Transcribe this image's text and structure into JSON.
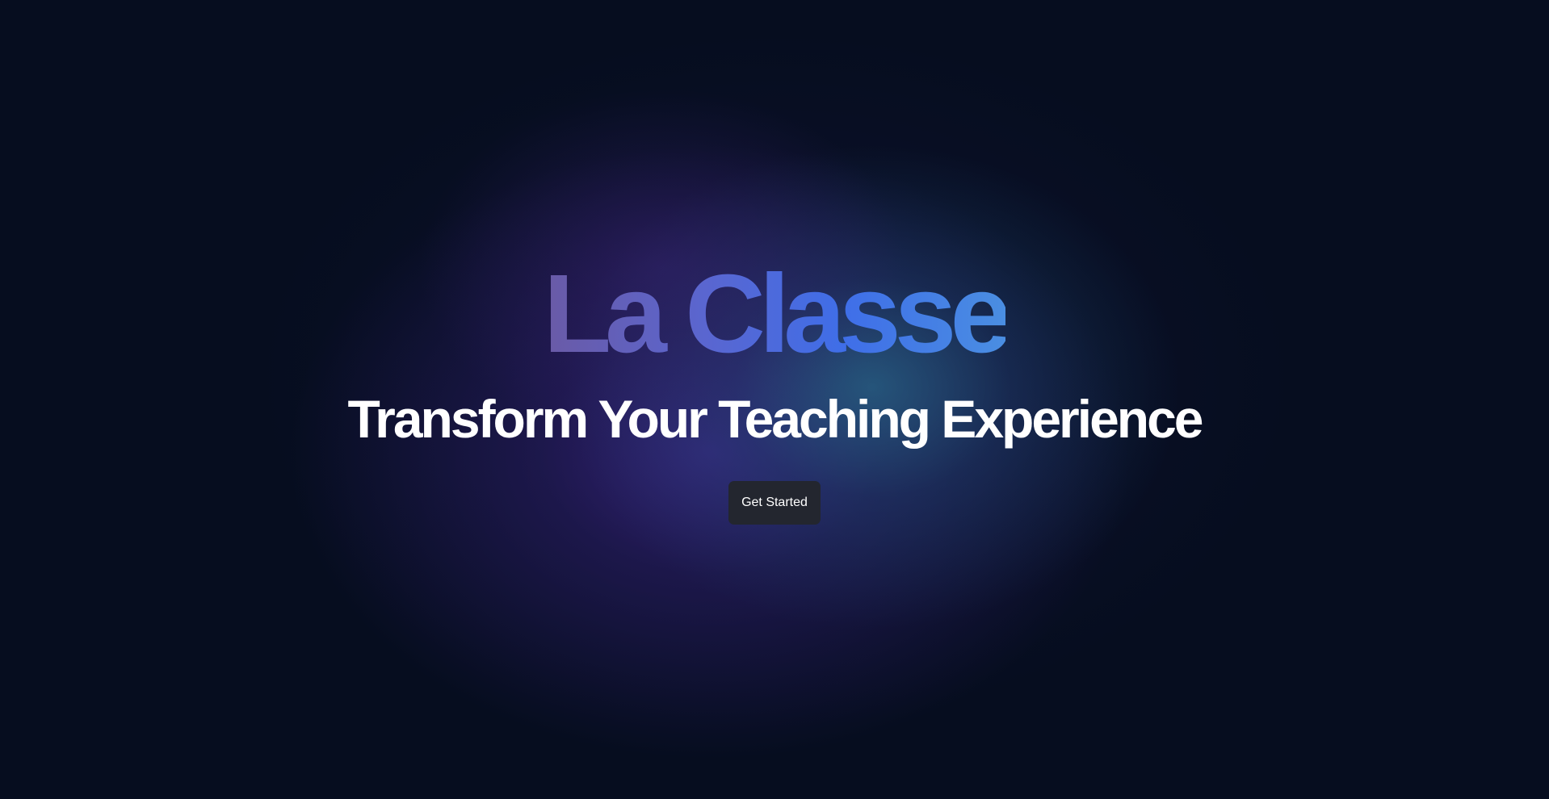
{
  "hero": {
    "brand": "La Classe",
    "headline": "Transform Your Teaching Experience",
    "cta_label": "Get Started"
  },
  "colors": {
    "background": "#060d1f",
    "brand_gradient_start": "#6a5aa6",
    "brand_gradient_end": "#4a8ee2",
    "headline": "#ffffff",
    "button_bg": "#23262f"
  }
}
